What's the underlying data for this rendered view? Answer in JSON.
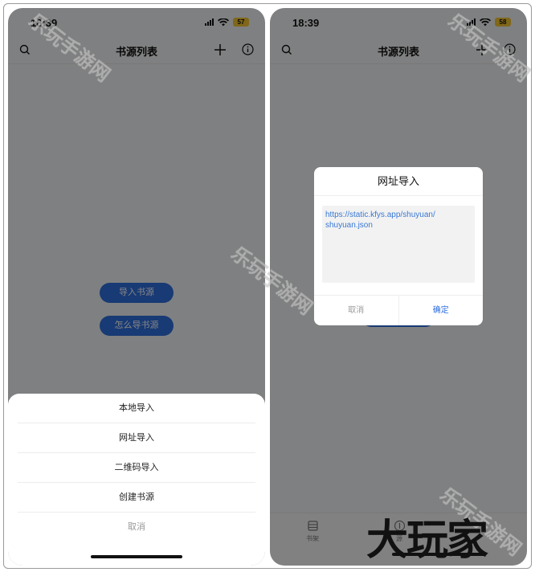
{
  "status": {
    "time": "18:39",
    "battery_left": "57",
    "battery_right": "58"
  },
  "nav": {
    "title": "书源列表"
  },
  "empty_state": {
    "import_label": "导入书源",
    "howto_label": "怎么导书源"
  },
  "action_sheet": {
    "items": [
      "本地导入",
      "网址导入",
      "二维码导入",
      "创建书源"
    ],
    "cancel_label": "取消"
  },
  "dialog": {
    "title": "网址导入",
    "url_value": "https://static.kfys.app/shuyuan/\nshuyuan.json",
    "cancel_label": "取消",
    "confirm_label": "确定"
  },
  "tabs": {
    "shelf_label": "书架",
    "sources_label": "源"
  },
  "watermark": {
    "text": "乐玩手游网"
  },
  "brand": {
    "text": "大玩家"
  },
  "colors": {
    "accent": "#2f6fe0",
    "battery": "#f5c631",
    "overlay": "rgba(0,0,0,0.48)"
  }
}
